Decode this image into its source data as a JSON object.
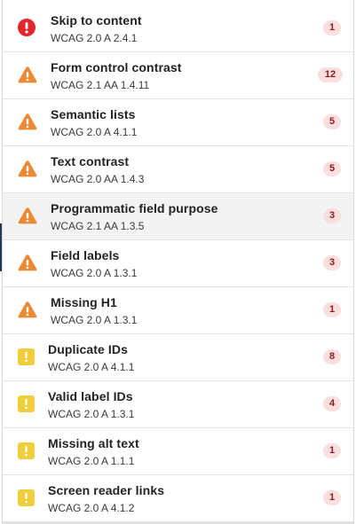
{
  "issues": [
    {
      "title": "Skip to content",
      "criterion": "WCAG 2.0 A 2.4.1",
      "count": "1",
      "severity": "error",
      "icon": "error-icon"
    },
    {
      "title": "Form control contrast",
      "criterion": "WCAG 2.1 AA 1.4.11",
      "count": "12",
      "severity": "warning",
      "icon": "warning-icon"
    },
    {
      "title": "Semantic lists",
      "criterion": "WCAG 2.0 A 4.1.1",
      "count": "5",
      "severity": "warning",
      "icon": "warning-icon"
    },
    {
      "title": "Text contrast",
      "criterion": "WCAG 2.0 AA 1.4.3",
      "count": "5",
      "severity": "warning",
      "icon": "warning-icon"
    },
    {
      "title": "Programmatic field purpose",
      "criterion": "WCAG 2.1 AA 1.3.5",
      "count": "3",
      "severity": "warning",
      "icon": "warning-icon"
    },
    {
      "title": "Field labels",
      "criterion": "WCAG 2.0 A 1.3.1",
      "count": "3",
      "severity": "warning",
      "icon": "warning-icon"
    },
    {
      "title": "Missing H1",
      "criterion": "WCAG 2.0 A 1.3.1",
      "count": "1",
      "severity": "warning",
      "icon": "warning-icon"
    },
    {
      "title": "Duplicate IDs",
      "criterion": "WCAG 2.0 A 4.1.1",
      "count": "8",
      "severity": "alert",
      "icon": "alert-icon"
    },
    {
      "title": "Valid label IDs",
      "criterion": "WCAG 2.0 A 1.3.1",
      "count": "4",
      "severity": "alert",
      "icon": "alert-icon"
    },
    {
      "title": "Missing alt text",
      "criterion": "WCAG 2.0 A 1.1.1",
      "count": "1",
      "severity": "alert",
      "icon": "alert-icon"
    },
    {
      "title": "Screen reader links",
      "criterion": "WCAG 2.0 A 4.1.2",
      "count": "1",
      "severity": "alert",
      "icon": "alert-icon"
    }
  ],
  "selected_index": 4,
  "colors": {
    "error": "#e3262c",
    "warning": "#ea8a33",
    "alert": "#efcd3b",
    "badge_bg": "#fbdede",
    "badge_text": "#8a1c1c",
    "selected_bg": "#f3f3f3"
  }
}
